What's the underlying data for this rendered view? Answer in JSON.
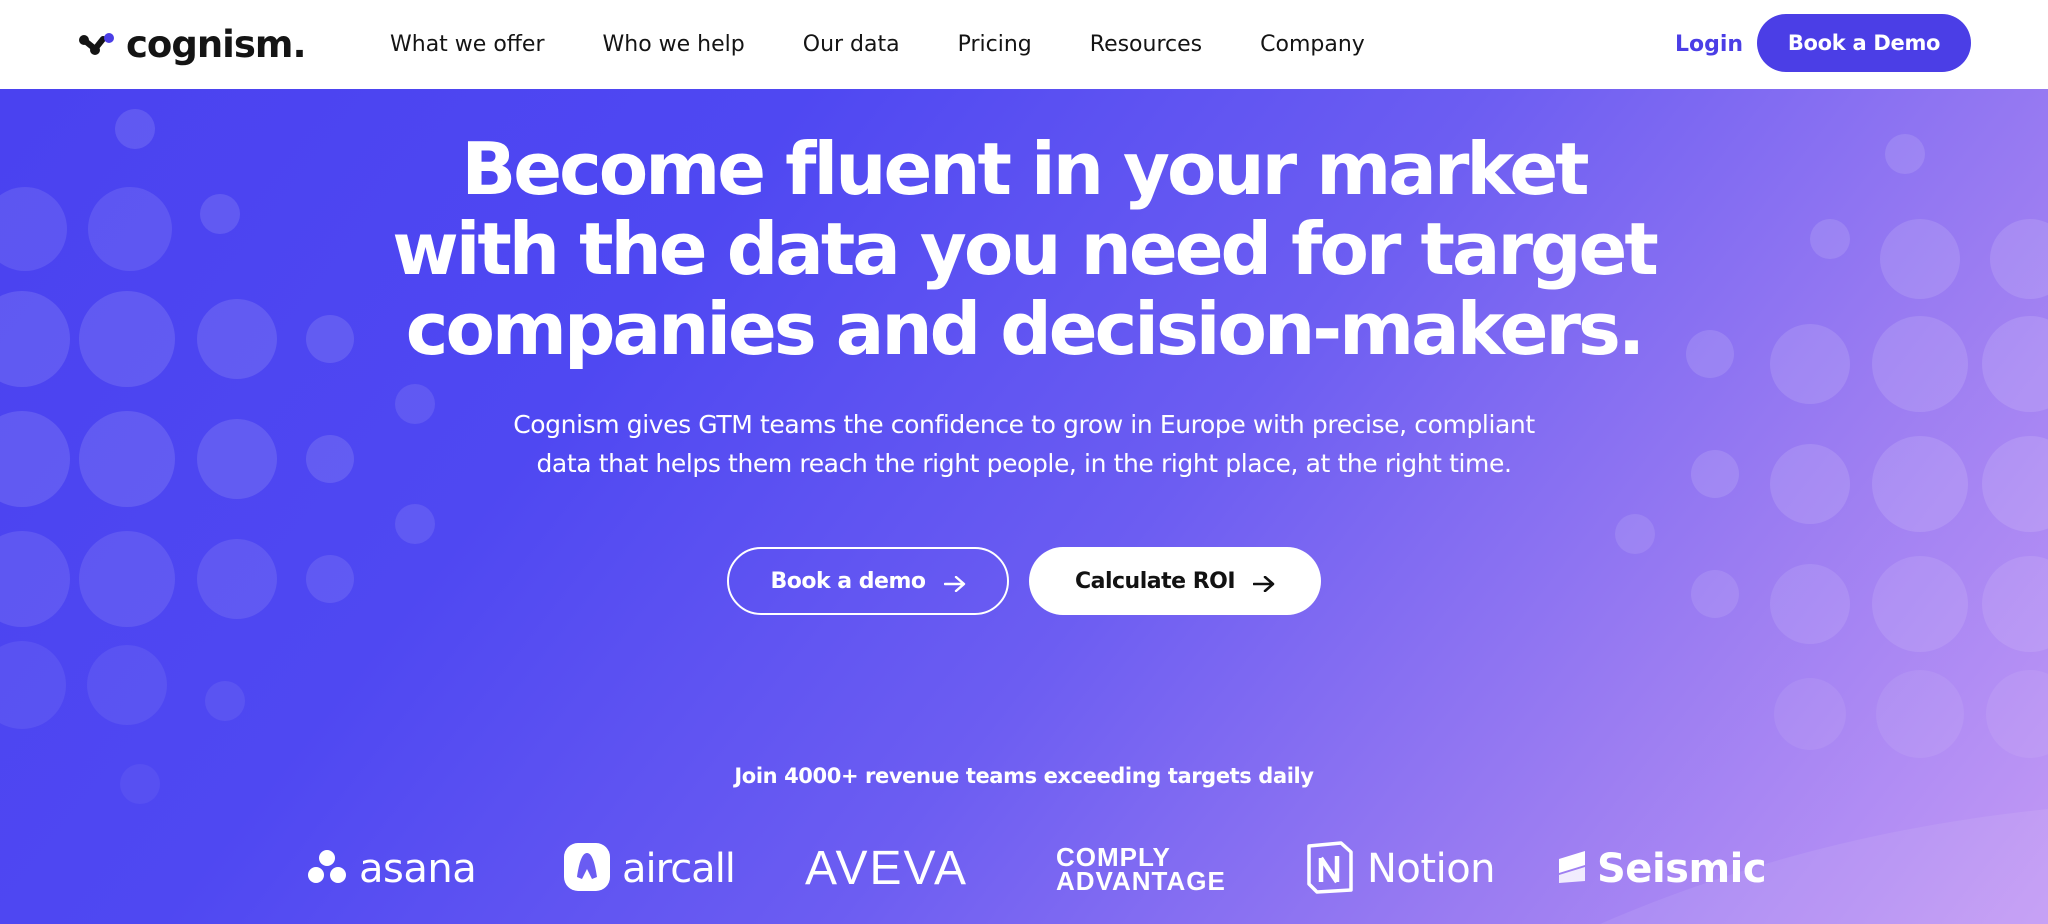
{
  "header": {
    "logo_text": "cognism.",
    "nav": [
      "What we offer",
      "Who we help",
      "Our data",
      "Pricing",
      "Resources",
      "Company"
    ],
    "login": "Login",
    "cta": "Book a Demo"
  },
  "hero": {
    "headline": [
      "Become fluent in your market",
      "with the data you need for target",
      "companies and decision-makers."
    ],
    "subtext": [
      "Cognism gives GTM teams the confidence to grow in Europe with precise, compliant",
      "data that helps them reach the right people, in the right place, at the right time."
    ],
    "primary_button": "Book a demo",
    "secondary_button": "Calculate ROI",
    "trust_line": "Join 4000+ revenue teams exceeding targets daily"
  },
  "customer_logos": {
    "asana": "asana",
    "aircall": "aircall",
    "aveva": "AVEVA",
    "comply_line1": "COMPLY",
    "comply_line2": "ADVANTAGE",
    "notion": "Notion",
    "seismic": "Seismic"
  },
  "colors": {
    "brand": "#4b3ee6",
    "hero_start": "#4a42f0",
    "hero_end": "#c39af5",
    "text_dark": "#141414",
    "white": "#ffffff"
  },
  "icons": [
    "cognism-logo-icon",
    "arrow-right-icon",
    "asana-logo-icon",
    "aircall-logo-icon",
    "notion-logo-icon",
    "seismic-logo-icon"
  ]
}
